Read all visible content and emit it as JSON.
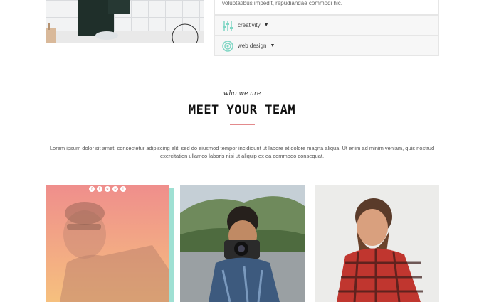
{
  "accordion": {
    "text": "voluptatibus impedit, repudiandae commodi hic.",
    "items": [
      {
        "label": "creativity",
        "icon": "sliders-icon"
      },
      {
        "label": "web design",
        "icon": "target-icon"
      }
    ],
    "accent_color": "#7fd6c4"
  },
  "team": {
    "eyebrow": "who we are",
    "title": "MEET YOUR TEAM",
    "description": "Lorem ipsum dolor sit amet, consectetur adipiscing elit, sed do eiusmod tempor incididunt ut labore et dolore magna aliqua. Ut enim ad minim veniam, quis nostrud exercitation ullamco laboris nisi ut aliquip ex ea commodo consequat.",
    "underline_color": "#e38a8c",
    "social_icons": [
      "f",
      "t",
      "g",
      "p",
      "i"
    ],
    "members": [
      {
        "photo": "member-photo-1"
      },
      {
        "photo": "member-photo-2"
      },
      {
        "photo": "member-photo-3"
      }
    ]
  }
}
